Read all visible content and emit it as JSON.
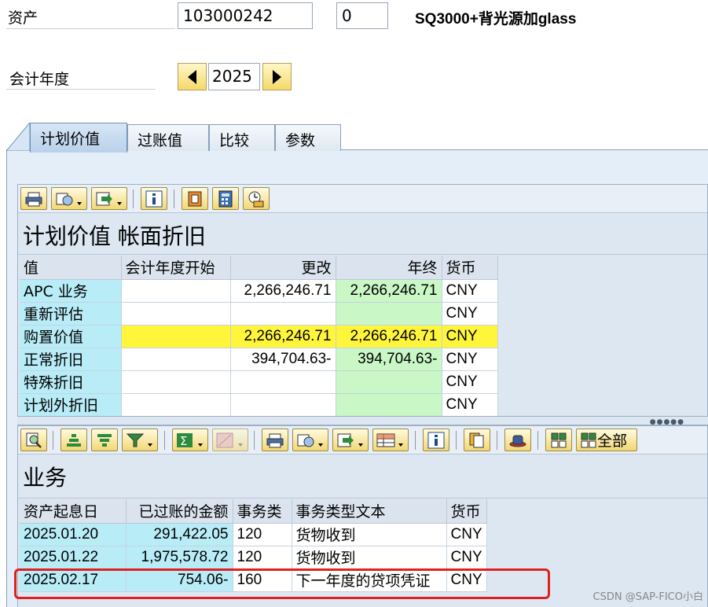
{
  "header": {
    "asset_label": "资产",
    "asset_number": "103000242",
    "sub_number": "0",
    "asset_description": "SQ3000+背光源加glass",
    "fiscal_year_label": "会计年度",
    "fiscal_year": "2025"
  },
  "tabs": [
    {
      "label": "计划价值",
      "active": true
    },
    {
      "label": "过账值",
      "active": false
    },
    {
      "label": "比较",
      "active": false
    },
    {
      "label": "参数",
      "active": false
    }
  ],
  "values_panel": {
    "title": "计划价值 帐面折旧",
    "columns": [
      "值",
      "会计年度开始",
      "更改",
      "年终",
      "货币"
    ],
    "rows": [
      {
        "value": "APC 业务",
        "start": "",
        "change": "2,266,246.71",
        "end": "2,266,246.71",
        "currency": "CNY"
      },
      {
        "value": "重新评估",
        "start": "",
        "change": "",
        "end": "",
        "currency": "CNY"
      },
      {
        "value": "购置价值",
        "start": "",
        "change": "2,266,246.71",
        "end": "2,266,246.71",
        "currency": "CNY"
      },
      {
        "value": "正常折旧",
        "start": "",
        "change": "394,704.63-",
        "end": "394,704.63-",
        "currency": "CNY"
      },
      {
        "value": "特殊折旧",
        "start": "",
        "change": "",
        "end": "",
        "currency": "CNY"
      },
      {
        "value": "计划外折旧",
        "start": "",
        "change": "",
        "end": "",
        "currency": "CNY"
      }
    ]
  },
  "transactions_panel": {
    "title": "业务",
    "all_button_label": "全部",
    "columns": [
      "资产起息日",
      "已过账的金额",
      "事务类",
      "事务类型文本",
      "货币"
    ],
    "rows": [
      {
        "date": "2025.01.20",
        "amount": "291,422.05",
        "type": "120",
        "text": "货物收到",
        "currency": "CNY"
      },
      {
        "date": "2025.01.22",
        "amount": "1,975,578.72",
        "type": "120",
        "text": "货物收到",
        "currency": "CNY"
      },
      {
        "date": "2025.02.17",
        "amount": "754.06-",
        "type": "160",
        "text": "下一年度的贷项凭证",
        "currency": "CNY"
      }
    ]
  },
  "watermark": "CSDN @SAP-FICO小白",
  "colors": {
    "key_cell": "#b8ecf7",
    "green_cell": "#c9f7c5",
    "highlight_row": "#fff53a",
    "red_box": "#e02020"
  }
}
